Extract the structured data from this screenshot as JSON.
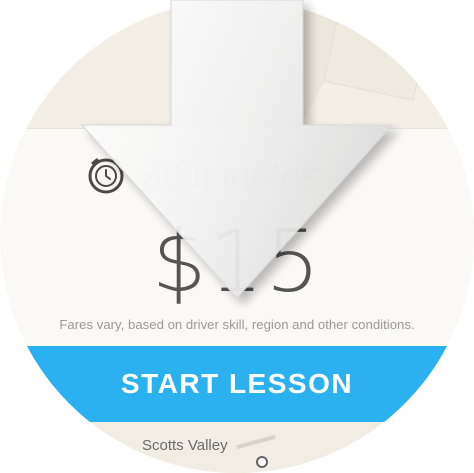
{
  "lesson": {
    "duration": "30 minutes",
    "price": "$15",
    "fare_note": "Fares vary, based on driver skill, region and other conditions.",
    "start_label": "START LESSON"
  },
  "map": {
    "place_label": "Scotts Valley"
  },
  "icons": {
    "clock": "alarm-clock-icon",
    "overlay": "download-arrow-icon"
  },
  "colors": {
    "accent": "#2bb0f0",
    "price_text": "#555555",
    "muted_text": "#9a9a9a"
  }
}
